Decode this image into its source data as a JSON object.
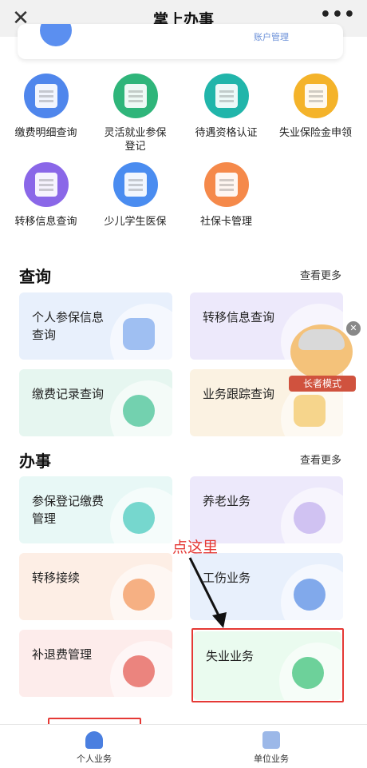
{
  "window": {
    "title": "掌上办事",
    "close_glyph": "✕",
    "more_glyph": "•••"
  },
  "top_card": {
    "partial_label": "账户管理"
  },
  "services": [
    {
      "label": "缴费明细查询",
      "icon": "receipt-search-icon",
      "color": "#4f86ec"
    },
    {
      "label": "灵活就业参保登记",
      "icon": "edit-form-icon",
      "color": "#2fb57a"
    },
    {
      "label": "待遇资格认证",
      "icon": "id-verify-icon",
      "color": "#21b5aa"
    },
    {
      "label": "失业保险金申领",
      "icon": "document-upload-icon",
      "color": "#f4b32a"
    },
    {
      "label": "转移信息查询",
      "icon": "transfer-share-icon",
      "color": "#8a67e8"
    },
    {
      "label": "少儿学生医保",
      "icon": "student-card-icon",
      "color": "#4a8cf0"
    },
    {
      "label": "社保卡管理",
      "icon": "bank-card-icon",
      "color": "#f5894a"
    }
  ],
  "query": {
    "title": "查询",
    "more": "查看更多",
    "tiles": [
      {
        "label": "个人参保信息查询",
        "icon": "insurance-doc-icon"
      },
      {
        "label": "转移信息查询",
        "icon": "clipboard-icon"
      },
      {
        "label": "缴费记录查询",
        "icon": "hand-coin-icon"
      },
      {
        "label": "业务跟踪查询",
        "icon": "tracking-doc-icon"
      }
    ]
  },
  "tasks": {
    "title": "办事",
    "more": "查看更多",
    "tiles": [
      {
        "label": "参保登记缴费管理",
        "icon": "money-bag-icon"
      },
      {
        "label": "养老业务",
        "icon": "elderly-person-icon"
      },
      {
        "label": "转移接续",
        "icon": "exchange-icon"
      },
      {
        "label": "工伤业务",
        "icon": "injury-person-icon"
      },
      {
        "label": "补退费管理",
        "icon": "refund-icon"
      },
      {
        "label": "失业业务",
        "icon": "unemployment-person-icon"
      }
    ]
  },
  "elder_mode": {
    "label": "长者模式",
    "close_glyph": "✕"
  },
  "annotation": {
    "text": "点这里"
  },
  "bottom_nav": [
    {
      "label": "个人业务",
      "icon": "person-icon",
      "active": true
    },
    {
      "label": "单位业务",
      "icon": "building-icon",
      "active": false
    }
  ],
  "colors": {
    "highlight": "#e53935",
    "active_nav": "#4a7fe0"
  }
}
